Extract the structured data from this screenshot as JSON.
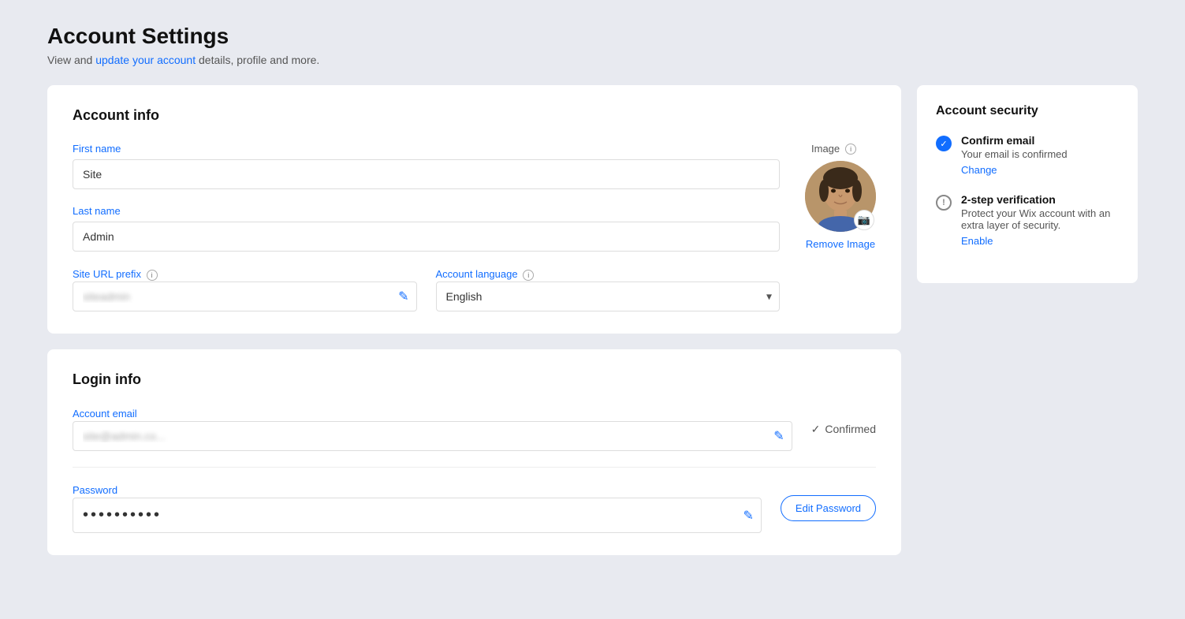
{
  "page": {
    "title": "Account Settings",
    "subtitle_text": "View and ",
    "subtitle_link": "update your account",
    "subtitle_rest": " details, profile and more."
  },
  "account_info": {
    "section_title": "Account info",
    "first_name": {
      "label": "First name",
      "value": "Site"
    },
    "last_name": {
      "label": "Last name",
      "value": "Admin"
    },
    "site_url": {
      "label": "Site URL prefix",
      "value": "siteadmin",
      "blurred": true
    },
    "account_language": {
      "label": "Account language",
      "value": "English"
    },
    "image": {
      "label": "Image",
      "remove_label": "Remove Image"
    }
  },
  "account_security": {
    "title": "Account security",
    "confirm_email": {
      "title": "Confirm email",
      "desc": "Your email is confirmed",
      "link": "Change"
    },
    "two_step": {
      "title": "2-step verification",
      "desc": "Protect your Wix account with an extra layer of security.",
      "link": "Enable"
    }
  },
  "login_info": {
    "section_title": "Login info",
    "email": {
      "label": "Account email",
      "value": "site@admin.co...",
      "blurred": true,
      "confirmed_label": "Confirmed"
    },
    "password": {
      "label": "Password",
      "value": "••••••••••",
      "edit_label": "Edit Password"
    }
  },
  "icons": {
    "info": "i",
    "edit": "✎",
    "camera": "📷",
    "chevron_down": "▾",
    "check": "✓",
    "warn": "!"
  }
}
